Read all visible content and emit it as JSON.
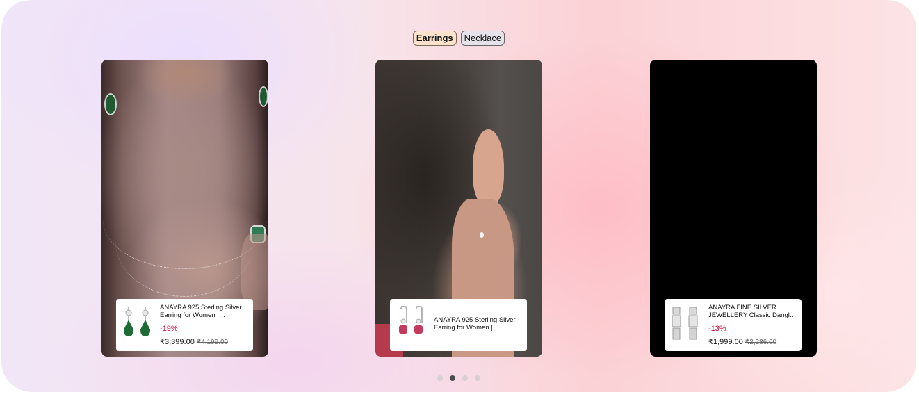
{
  "tabs": [
    {
      "label": "Earrings",
      "active": true
    },
    {
      "label": "Necklace",
      "active": false
    }
  ],
  "cards": [
    {
      "product": {
        "title": "ANAYRA 925 Sterling Silver Earring for Women | Hallmarked Silver Earrings",
        "discount": "-19%",
        "price": "₹3,399.00",
        "mrp": "₹4,199.00",
        "stone_color": "#1f6b35"
      }
    },
    {
      "product": {
        "title": "ANAYRA 925 Sterling Silver Earring for Women | Hallmarked Silver Earrings",
        "discount": "",
        "price": "",
        "mrp": "",
        "stone_color": "#c23a5e"
      }
    },
    {
      "product": {
        "title": "ANAYRA FINE SILVER JEWELLERY Classic Dangler Earrings",
        "discount": "-13%",
        "price": "₹1,999.00",
        "mrp": "₹2,286.00",
        "stone_color": "#c9c9c9"
      }
    }
  ],
  "pagination": {
    "total": 4,
    "active_index": 1
  },
  "colors": {
    "accent_tab": "#fde3cc",
    "discount": "#cc0c39"
  }
}
